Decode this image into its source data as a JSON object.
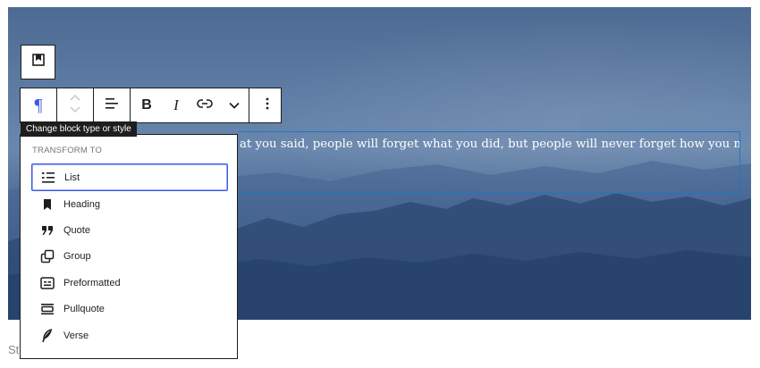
{
  "editor": {
    "paragraph_text": "at you said, people will forget what you did, but people will never forget how you made",
    "footer_text": "St"
  },
  "toolbar": {
    "tooltip": "Change block type or style",
    "buttons": {
      "paragraph": "¶",
      "bold": "B",
      "italic": "I"
    }
  },
  "transform_menu": {
    "heading": "TRANSFORM TO",
    "items": [
      {
        "label": "List",
        "icon": "list-icon"
      },
      {
        "label": "Heading",
        "icon": "bookmark-icon"
      },
      {
        "label": "Quote",
        "icon": "quote-icon"
      },
      {
        "label": "Group",
        "icon": "group-icon"
      },
      {
        "label": "Preformatted",
        "icon": "preformatted-icon"
      },
      {
        "label": "Pullquote",
        "icon": "pullquote-icon"
      },
      {
        "label": "Verse",
        "icon": "feather-icon"
      }
    ]
  },
  "colors": {
    "accent": "#3858e9",
    "focus_border": "#1c78c4",
    "text": "#1e1e1e",
    "cover_bg": "#4f6d98"
  }
}
